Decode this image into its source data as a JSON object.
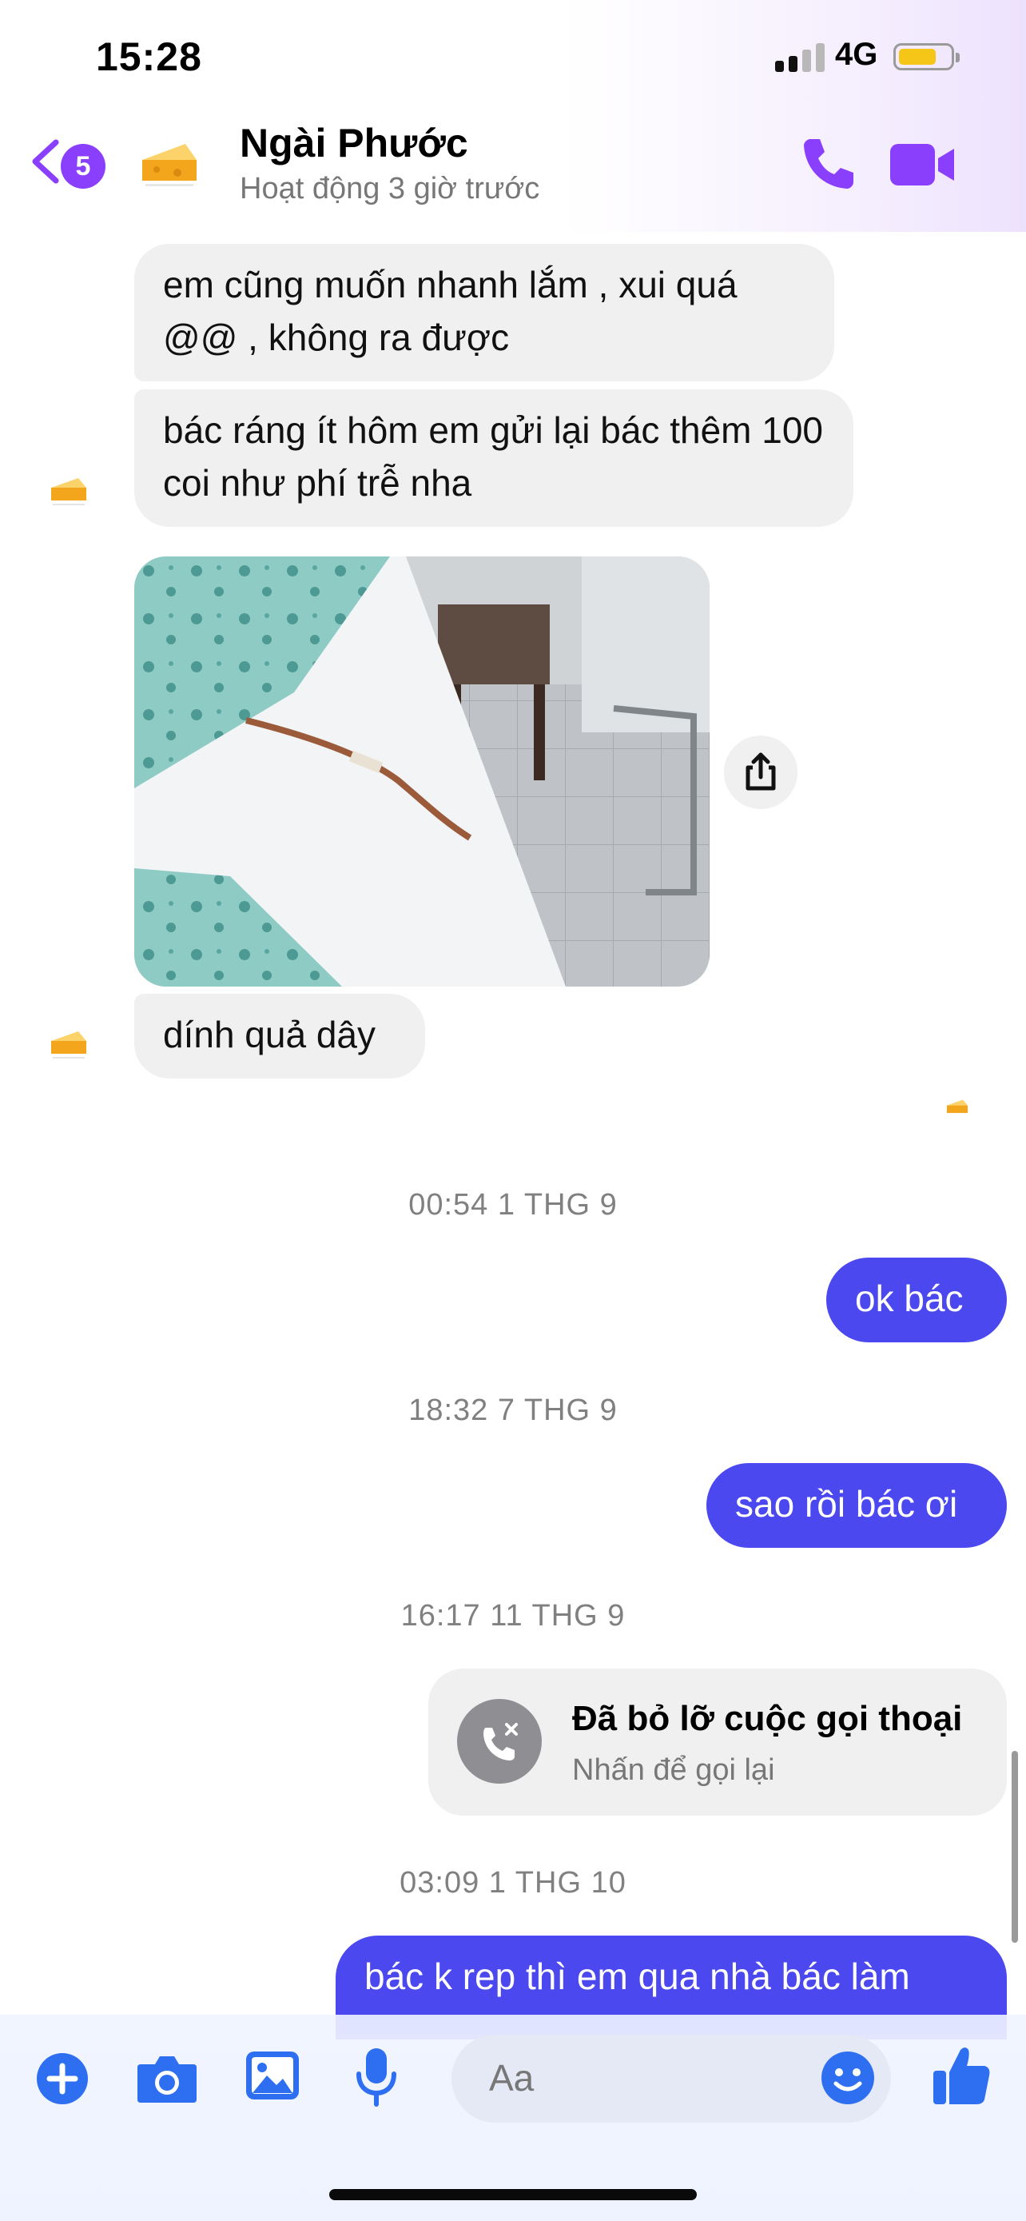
{
  "status_bar": {
    "time": "15:28",
    "network": "4G"
  },
  "header": {
    "back_badge": "5",
    "contact_name": "Ngài Phước",
    "contact_status": "Hoạt động 3 giờ trước"
  },
  "messages": {
    "in_1": "em cũng muốn nhanh lắm , xui quá @@ , không ra được",
    "in_2": "bác ráng ít hôm em gửi lại bác thêm 100 coi như phí trễ nha",
    "in_3": "dính quả dây",
    "ts_1": "00:54 1 THG 9",
    "out_1": "ok bác",
    "ts_2": "18:32 7 THG 9",
    "out_2": "sao rồi bác ơi",
    "ts_3": "16:17 11 THG 9",
    "missed_call_title": "Đã bỏ lỡ cuộc gọi thoại",
    "missed_call_sub": "Nhấn để gọi lại",
    "ts_4": "03:09 1 THG 10",
    "out_3": "bác k rep thì em qua nhà bác làm"
  },
  "composer": {
    "placeholder": "Aa"
  },
  "colors": {
    "accent": "#8a3ffc",
    "outgoing_bubble": "#4b48f0",
    "incoming_bubble": "#f0f0f0",
    "composer_icons": "#2e6ef0"
  },
  "icons": [
    "back-chevron-icon",
    "phone-icon",
    "video-camera-icon",
    "share-icon",
    "missed-call-icon",
    "plus-icon",
    "camera-icon",
    "gallery-icon",
    "microphone-icon",
    "emoji-icon",
    "thumbs-up-icon",
    "cheese-avatar"
  ]
}
